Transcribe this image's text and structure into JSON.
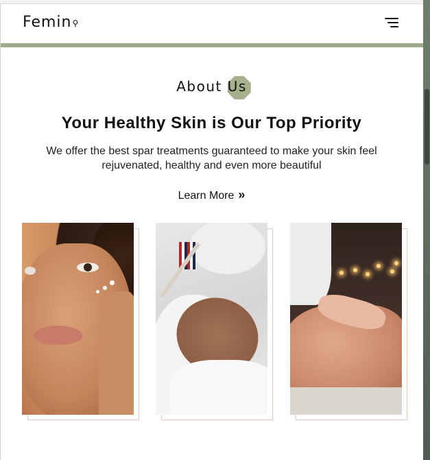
{
  "brand": {
    "name": "Femin",
    "glyph": "⚲"
  },
  "nav": {
    "menu_icon": "hamburger-menu-icon"
  },
  "about": {
    "eyebrow_main": "About ",
    "eyebrow_highlight": "Us",
    "headline": "Your Healthy Skin is Our Top Priority",
    "description": "We offer the best spar treatments guaranteed to make your skin feel rejuvenated, healthy and even more beautiful",
    "cta_label": "Learn More",
    "cta_icon": "»"
  },
  "gallery": [
    {
      "subject": "skin-care-face"
    },
    {
      "subject": "facial-mask"
    },
    {
      "subject": "back-massage"
    }
  ],
  "colors": {
    "accent_green": "#9ca98a",
    "blob": "#a6b08c",
    "card_border": "#e5c9bd"
  }
}
